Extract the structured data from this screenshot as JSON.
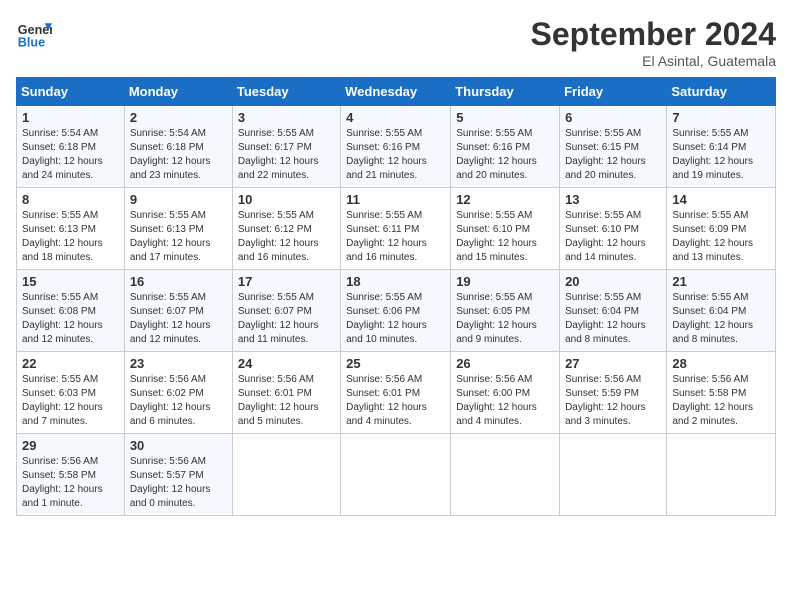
{
  "header": {
    "logo_text_general": "General",
    "logo_text_blue": "Blue",
    "month": "September 2024",
    "location": "El Asintal, Guatemala"
  },
  "days_of_week": [
    "Sunday",
    "Monday",
    "Tuesday",
    "Wednesday",
    "Thursday",
    "Friday",
    "Saturday"
  ],
  "weeks": [
    [
      {
        "day": "1",
        "sunrise": "5:54 AM",
        "sunset": "6:18 PM",
        "daylight": "12 hours and 24 minutes."
      },
      {
        "day": "2",
        "sunrise": "5:54 AM",
        "sunset": "6:18 PM",
        "daylight": "12 hours and 23 minutes."
      },
      {
        "day": "3",
        "sunrise": "5:55 AM",
        "sunset": "6:17 PM",
        "daylight": "12 hours and 22 minutes."
      },
      {
        "day": "4",
        "sunrise": "5:55 AM",
        "sunset": "6:16 PM",
        "daylight": "12 hours and 21 minutes."
      },
      {
        "day": "5",
        "sunrise": "5:55 AM",
        "sunset": "6:16 PM",
        "daylight": "12 hours and 20 minutes."
      },
      {
        "day": "6",
        "sunrise": "5:55 AM",
        "sunset": "6:15 PM",
        "daylight": "12 hours and 20 minutes."
      },
      {
        "day": "7",
        "sunrise": "5:55 AM",
        "sunset": "6:14 PM",
        "daylight": "12 hours and 19 minutes."
      }
    ],
    [
      {
        "day": "8",
        "sunrise": "5:55 AM",
        "sunset": "6:13 PM",
        "daylight": "12 hours and 18 minutes."
      },
      {
        "day": "9",
        "sunrise": "5:55 AM",
        "sunset": "6:13 PM",
        "daylight": "12 hours and 17 minutes."
      },
      {
        "day": "10",
        "sunrise": "5:55 AM",
        "sunset": "6:12 PM",
        "daylight": "12 hours and 16 minutes."
      },
      {
        "day": "11",
        "sunrise": "5:55 AM",
        "sunset": "6:11 PM",
        "daylight": "12 hours and 16 minutes."
      },
      {
        "day": "12",
        "sunrise": "5:55 AM",
        "sunset": "6:10 PM",
        "daylight": "12 hours and 15 minutes."
      },
      {
        "day": "13",
        "sunrise": "5:55 AM",
        "sunset": "6:10 PM",
        "daylight": "12 hours and 14 minutes."
      },
      {
        "day": "14",
        "sunrise": "5:55 AM",
        "sunset": "6:09 PM",
        "daylight": "12 hours and 13 minutes."
      }
    ],
    [
      {
        "day": "15",
        "sunrise": "5:55 AM",
        "sunset": "6:08 PM",
        "daylight": "12 hours and 12 minutes."
      },
      {
        "day": "16",
        "sunrise": "5:55 AM",
        "sunset": "6:07 PM",
        "daylight": "12 hours and 12 minutes."
      },
      {
        "day": "17",
        "sunrise": "5:55 AM",
        "sunset": "6:07 PM",
        "daylight": "12 hours and 11 minutes."
      },
      {
        "day": "18",
        "sunrise": "5:55 AM",
        "sunset": "6:06 PM",
        "daylight": "12 hours and 10 minutes."
      },
      {
        "day": "19",
        "sunrise": "5:55 AM",
        "sunset": "6:05 PM",
        "daylight": "12 hours and 9 minutes."
      },
      {
        "day": "20",
        "sunrise": "5:55 AM",
        "sunset": "6:04 PM",
        "daylight": "12 hours and 8 minutes."
      },
      {
        "day": "21",
        "sunrise": "5:55 AM",
        "sunset": "6:04 PM",
        "daylight": "12 hours and 8 minutes."
      }
    ],
    [
      {
        "day": "22",
        "sunrise": "5:55 AM",
        "sunset": "6:03 PM",
        "daylight": "12 hours and 7 minutes."
      },
      {
        "day": "23",
        "sunrise": "5:56 AM",
        "sunset": "6:02 PM",
        "daylight": "12 hours and 6 minutes."
      },
      {
        "day": "24",
        "sunrise": "5:56 AM",
        "sunset": "6:01 PM",
        "daylight": "12 hours and 5 minutes."
      },
      {
        "day": "25",
        "sunrise": "5:56 AM",
        "sunset": "6:01 PM",
        "daylight": "12 hours and 4 minutes."
      },
      {
        "day": "26",
        "sunrise": "5:56 AM",
        "sunset": "6:00 PM",
        "daylight": "12 hours and 4 minutes."
      },
      {
        "day": "27",
        "sunrise": "5:56 AM",
        "sunset": "5:59 PM",
        "daylight": "12 hours and 3 minutes."
      },
      {
        "day": "28",
        "sunrise": "5:56 AM",
        "sunset": "5:58 PM",
        "daylight": "12 hours and 2 minutes."
      }
    ],
    [
      {
        "day": "29",
        "sunrise": "5:56 AM",
        "sunset": "5:58 PM",
        "daylight": "12 hours and 1 minute."
      },
      {
        "day": "30",
        "sunrise": "5:56 AM",
        "sunset": "5:57 PM",
        "daylight": "12 hours and 0 minutes."
      },
      null,
      null,
      null,
      null,
      null
    ]
  ]
}
